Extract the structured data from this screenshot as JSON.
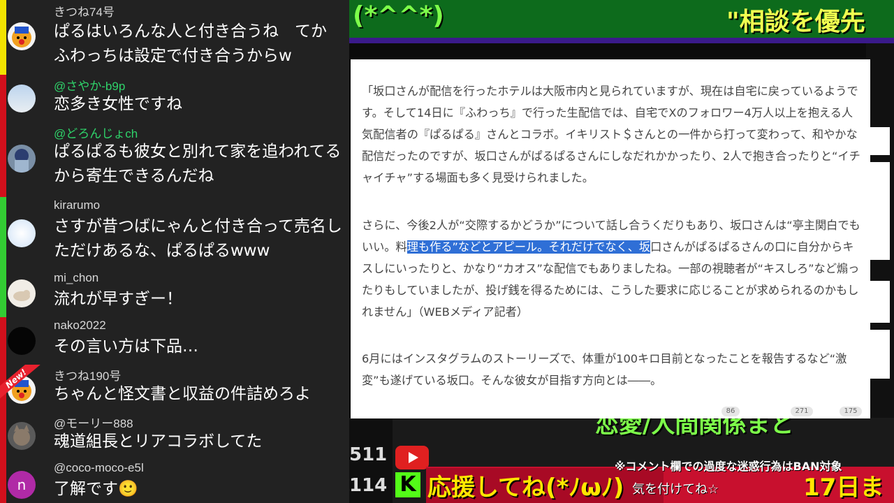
{
  "background": {
    "title_left": "(*^^*)",
    "title_right": "\"相談を優先",
    "support_text": "応援してね(*ﾉωﾉ)",
    "date_text": "17日ま",
    "subtitle": "恋愛/人間関係まと",
    "notice": "※コメント欄での過度な迷惑行為はBAN対象",
    "care": "気を付けてね☆",
    "stats": [
      "511",
      "114"
    ]
  },
  "chat": {
    "messages": [
      {
        "name": "きつね74号",
        "text": "ぱるはいろんな人と付き合うね　てか　ふわっちは設定で付き合うからw",
        "bar_color": "#f2e300"
      },
      {
        "name": "@さやか-b9p",
        "text": "恋多き女性ですね",
        "bar_color": "#d1101c"
      },
      {
        "name": "@どろんじょch",
        "text": "ぱるぱるも彼女と別れて家を追われてるから寄生できるんだね",
        "bar_color": "#d1101c"
      },
      {
        "name": "kirarumo",
        "text": "さすが昔つばにゃんと付き合って売名しただけあるな、ぱるぱるwww",
        "bar_color": "#33cc33"
      },
      {
        "name": "mi_chon",
        "text": "流れが早すぎー！",
        "bar_color": "#33cc33"
      },
      {
        "name": "nako2022",
        "text": "その言い方は下品…",
        "bar_color": "#d1101c"
      },
      {
        "name": "きつね190号",
        "text": "ちゃんと怪文書と収益の件詰めろよ",
        "bar_color": "#d1101c",
        "badge": "New!"
      },
      {
        "name": "@モーリー888",
        "text": "魂道組長とリアコラボしてた",
        "bar_color": "#d1101c"
      },
      {
        "name": "@coco-moco-e5l",
        "text": "了解です",
        "emoji": "🙂",
        "bar_color": "#d1101c",
        "avatar_letter": "n"
      }
    ]
  },
  "article": {
    "p1": "「坂口さんが配信を行ったホテルは大阪市内と見られていますが、現在は自宅に戻っているようです。そして14日に『ふわっち』で行った生配信では、自宅でXのフォロワー4万人以上を抱える人気配信者の『ぱるぱる』さんとコラボ。イキリスト＄さんとの一件から打って変わって、和やかな配信だったのですが、坂口さんがぱるぱるさんにしなだれかかったり、2人で抱き合ったりと“イチャイチャ”する場面も多く見受けられました。",
    "p2_before": "さらに、今後2人が“交際するかどうか”について話し合うくだりもあり、坂口さんは“亭主関白でもいい。料",
    "p2_highlight": "理も作る”などとアピール。それだけでなく、坂",
    "p2_after": "口さんがぱるぱるさんの口に自分からキスしにいったりと、かなり“カオス”な配信でもありましたね。一部の視聴者が“キスしろ”など煽ったりもしていましたが、投げ銭を得るためには、こうした要求に応じることが求められるのかもしれません」（WEBメディア記者）",
    "p3": "6月にはインスタグラムのストーリーズで、体重が100キロ目前となったことを報告するなど“激変”も遂げている坂口。そんな彼女が目指す方向とは――。",
    "reactions": [
      "86",
      "271",
      "175"
    ]
  }
}
